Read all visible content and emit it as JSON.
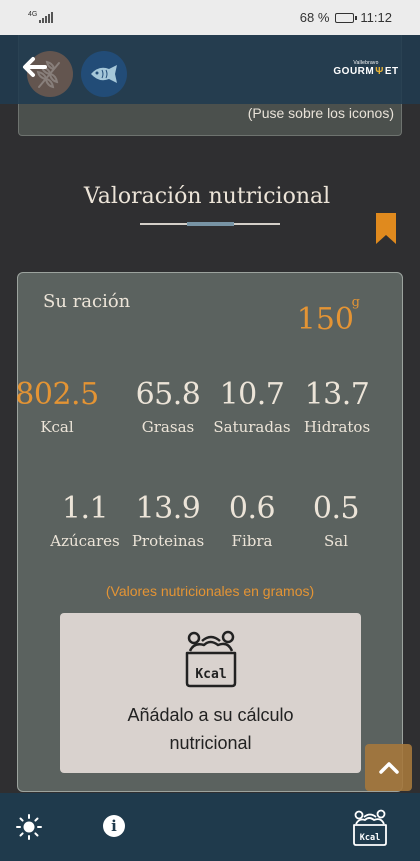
{
  "status_bar": {
    "signal": "4G",
    "battery_percent": "68 %",
    "battery_level": 0.68,
    "time": "11:12"
  },
  "nav": {
    "back_icon": "back-arrow-icon",
    "category_icons": [
      "wheat-icon",
      "fish-icon"
    ],
    "brand_small": "Vallebravo",
    "brand_big_left": "GOURM",
    "brand_big_right": "ET"
  },
  "top_section": {
    "hover_note": "(Puse sobre los iconos)"
  },
  "nutrition": {
    "title": "Valoración nutricional",
    "ration_label": "Su ración",
    "ration_amount": "150",
    "ration_unit": "g",
    "items": [
      {
        "value": "802.5",
        "label": "Kcal"
      },
      {
        "value": "65.8",
        "label": "Grasas"
      },
      {
        "value": "10.7",
        "label": "Saturadas"
      },
      {
        "value": "13.7",
        "label": "Hidratos"
      },
      {
        "value": "1.1",
        "label": "Azúcares"
      },
      {
        "value": "13.9",
        "label": "Proteinas"
      },
      {
        "value": "0.6",
        "label": "Fibra"
      },
      {
        "value": "0.5",
        "label": "Sal"
      }
    ],
    "values_note": "(Valores nutricionales en gramos)",
    "add_text_line1": "Añádalo a su cálculo",
    "add_text_line2": "nutricional",
    "kcal_icon_label": "Kcal"
  },
  "colors": {
    "accent": "#e49434",
    "nav_bg": "#203b4f",
    "card_bg": "#5b625f",
    "page_bg": "#2f2f31"
  },
  "bottom_bar": {
    "icons": [
      "sun-icon",
      "info-icon",
      "kcal-basket-icon"
    ],
    "info_glyph": "i",
    "kcal_label": "Kcal"
  }
}
